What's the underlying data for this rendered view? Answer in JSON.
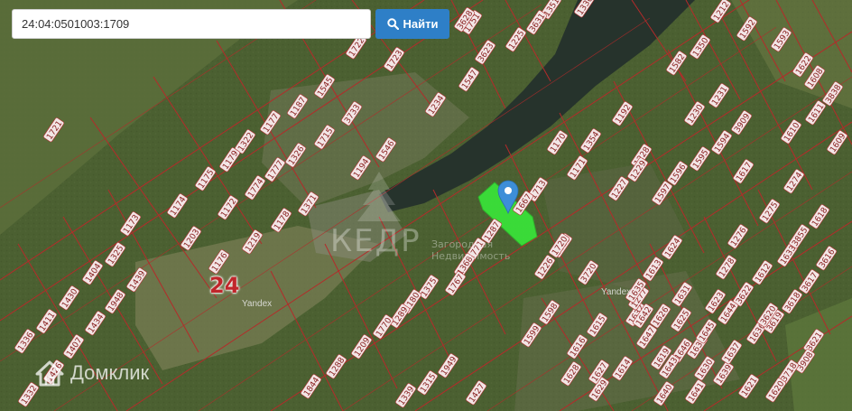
{
  "search": {
    "query": "24:04:0501003:1709",
    "button_label": "Найти",
    "button_icon": "search-icon"
  },
  "map": {
    "zone_label": "24",
    "attribution": "Yandex",
    "highlight_color": "#38f03a",
    "marker_color": "#3d8ed8",
    "parcel_border_color": "#b52a2a"
  },
  "watermarks": {
    "domclick": "Домклик",
    "kedr_title": "КЕДР",
    "kedr_subtitle": "Загородная Недвижимость"
  },
  "parcels": [
    "525",
    "1543",
    "1428",
    "1975",
    "1976",
    "1978",
    "1979",
    "1547",
    "1234",
    "1545",
    "3733",
    "1187",
    "1177",
    "1715",
    "1546",
    "1322",
    "1326",
    "1179",
    "1175",
    "1777",
    "1774",
    "1194",
    "1172",
    "1371",
    "1178",
    "1173",
    "1174",
    "1203",
    "1219",
    "1176",
    "1325",
    "1404",
    "1439",
    "1430",
    "1411",
    "1948",
    "1434",
    "1336",
    "1407",
    "1426",
    "1332",
    "1751",
    "1354",
    "1170",
    "1171",
    "1713",
    "1667",
    "1287",
    "1771",
    "1368",
    "1375",
    "1767",
    "1180",
    "1289",
    "1770",
    "1209",
    "1288",
    "1844",
    "1949",
    "1315",
    "1427",
    "1339",
    "3623",
    "3720",
    "1226",
    "1598",
    "1599",
    "1615",
    "1616",
    "1628",
    "1629",
    "1614",
    "1613",
    "1624",
    "1631",
    "1632",
    "1633",
    "1612",
    "1623",
    "1627",
    "1640",
    "1641",
    "1639",
    "1638",
    "1636",
    "1637",
    "1192",
    "1228",
    "1227",
    "1229",
    "1597",
    "1596",
    "1595",
    "1594",
    "1230",
    "1231",
    "3909",
    "1274",
    "1275",
    "1276",
    "1610",
    "1611",
    "3838",
    "1608",
    "1609",
    "1622",
    "1593",
    "1592",
    "1582",
    "1350",
    "1212",
    "1336",
    "1351",
    "1617",
    "1618",
    "3855",
    "3616",
    "3617",
    "3618",
    "3619",
    "3620",
    "3621",
    "3622",
    "3908",
    "3718",
    "1620",
    "1621",
    "1644",
    "1645",
    "1646",
    "1647",
    "1619",
    "1277",
    "1278",
    "1625",
    "1626",
    "1630",
    "1635",
    "1642",
    "1643",
    "1720",
    "1721",
    "1722",
    "1723",
    "3628",
    "3631",
    "1225",
    "3623"
  ]
}
